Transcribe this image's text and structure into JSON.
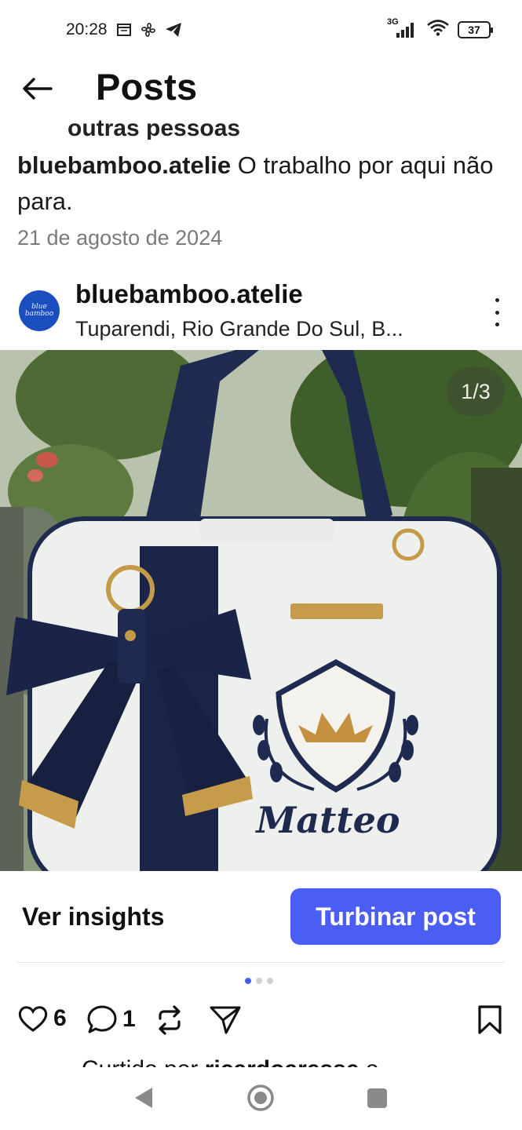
{
  "status_bar": {
    "time": "20:28",
    "network": "3G",
    "battery": "37"
  },
  "header": {
    "title": "Posts"
  },
  "caption": {
    "cut_text": "outras pessoas",
    "handle": "bluebamboo.atelie",
    "text": " O trabalho por aqui não para.",
    "date": "21 de agosto de 2024"
  },
  "post": {
    "username": "bluebamboo.atelie",
    "location": "Tuparendi, Rio Grande Do Sul, B...",
    "avatar_text": "blue bamboo",
    "carousel_counter": "1/3",
    "embroidered_name": "Matteo"
  },
  "actions": {
    "insights_label": "Ver insights",
    "boost_label": "Turbinar post",
    "likes": "6",
    "comments": "1",
    "liked_by_prefix": "Curtido por ",
    "liked_by_user": "ricardoaresse",
    "liked_by_suffix": " e"
  },
  "colors": {
    "accent": "#4a5df5",
    "avatar_bg": "#1b4fbf"
  }
}
